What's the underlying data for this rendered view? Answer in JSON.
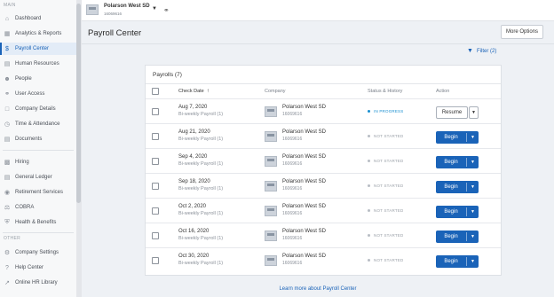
{
  "sidebar": {
    "section_main": "MAIN",
    "section_other": "OTHER",
    "items": [
      {
        "label": "Dashboard",
        "icon": "home-icon"
      },
      {
        "label": "Analytics & Reports",
        "icon": "chart-icon"
      },
      {
        "label": "Payroll Center",
        "icon": "dollar-icon",
        "active": true
      },
      {
        "label": "Human Resources",
        "icon": "id-card-icon"
      },
      {
        "label": "People",
        "icon": "person-icon"
      },
      {
        "label": "User Access",
        "icon": "key-icon"
      },
      {
        "label": "Company Details",
        "icon": "building-icon"
      },
      {
        "label": "Time & Attendance",
        "icon": "clock-icon"
      },
      {
        "label": "Documents",
        "icon": "document-icon"
      },
      {
        "label": "Hiring",
        "icon": "clipboard-icon"
      },
      {
        "label": "General Ledger",
        "icon": "ledger-icon"
      },
      {
        "label": "Retirement Services",
        "icon": "piggy-bank-icon"
      },
      {
        "label": "COBRA",
        "icon": "scale-icon"
      },
      {
        "label": "Health & Benefits",
        "icon": "shield-icon"
      }
    ],
    "other_items": [
      {
        "label": "Company Settings",
        "icon": "gear-icon"
      },
      {
        "label": "Help Center",
        "icon": "help-icon"
      },
      {
        "label": "Online HR Library",
        "icon": "external-link-icon"
      }
    ]
  },
  "company": {
    "name": "Polarson West SD",
    "id": "16069616"
  },
  "header": {
    "title": "Payroll Center",
    "more_options": "More Options",
    "filter": "Filter (2)"
  },
  "payrolls": {
    "title": "Payrolls (7)",
    "columns": {
      "check_date": "Check Date",
      "company": "Company",
      "status": "Status & History",
      "action": "Action"
    },
    "rows": [
      {
        "date": "Aug 7, 2020",
        "type": "Bi-weekly Payroll (1)",
        "company": "Polarson West SD",
        "company_id": "16069616",
        "status": "IN PROGRESS",
        "action": "Resume"
      },
      {
        "date": "Aug 21, 2020",
        "type": "Bi-weekly Payroll (1)",
        "company": "Polarson West SD",
        "company_id": "16069616",
        "status": "NOT STARTED",
        "action": "Begin"
      },
      {
        "date": "Sep 4, 2020",
        "type": "Bi-weekly Payroll (1)",
        "company": "Polarson West SD",
        "company_id": "16069616",
        "status": "NOT STARTED",
        "action": "Begin"
      },
      {
        "date": "Sep 18, 2020",
        "type": "Bi-weekly Payroll (1)",
        "company": "Polarson West SD",
        "company_id": "16069616",
        "status": "NOT STARTED",
        "action": "Begin"
      },
      {
        "date": "Oct 2, 2020",
        "type": "Bi-weekly Payroll (1)",
        "company": "Polarson West SD",
        "company_id": "16069616",
        "status": "NOT STARTED",
        "action": "Begin"
      },
      {
        "date": "Oct 16, 2020",
        "type": "Bi-weekly Payroll (1)",
        "company": "Polarson West SD",
        "company_id": "16069616",
        "status": "NOT STARTED",
        "action": "Begin"
      },
      {
        "date": "Oct 30, 2020",
        "type": "Bi-weekly Payroll (1)",
        "company": "Polarson West SD",
        "company_id": "16069616",
        "status": "NOT STARTED",
        "action": "Begin"
      }
    ]
  },
  "footer": {
    "learn_more": "Learn more about Payroll Center"
  },
  "colors": {
    "accent": "#1a63b8",
    "in_progress": "#1a8fd0"
  }
}
